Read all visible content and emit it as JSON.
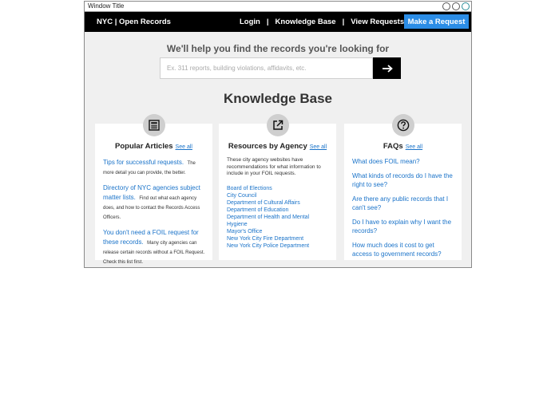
{
  "window": {
    "title": "Window Title"
  },
  "nav": {
    "brand": "NYC | Open Records",
    "links": [
      "Login",
      "Knowledge Base",
      "View Requests"
    ],
    "separator": "|",
    "cta_label": "Make a Request"
  },
  "hero": {
    "title": "We'll help you find the records you're looking for",
    "search_placeholder": "Ex. 311 reports, building violations, affidavits, etc.",
    "search_button_icon": "arrow-right-icon"
  },
  "kb_title": "Knowledge Base",
  "cards": {
    "popular": {
      "icon": "newspaper-icon",
      "title": "Popular Articles",
      "see_all": "See all",
      "articles": [
        {
          "link": "Tips for successful requests.",
          "desc": "The more detail you can provide, the better."
        },
        {
          "link": "Directory of NYC agencies subject matter lists.",
          "desc": "Find out what each agency does, and how to contact the Records Access Officers."
        },
        {
          "link": "You don't need a FOIL request for these records.",
          "desc": "Many city agencies can release certain records without a FOIL Request. Check this list first."
        }
      ]
    },
    "resources": {
      "icon": "external-link-icon",
      "title": "Resources by Agency",
      "see_all": "See all",
      "intro": "These city agency websites have recommendations for what information to include in your FOIL requests.",
      "agencies": [
        "Board of Elections",
        "City Council",
        "Department of Cultural Affairs",
        "Department of Education",
        "Department of Health and Mental Hygiene",
        "Mayor's Office",
        "New York City Fire Department",
        "New York City Police Department"
      ]
    },
    "faqs": {
      "icon": "question-icon",
      "title": "FAQs",
      "see_all": "See all",
      "questions": [
        "What does FOIL mean?",
        "What kinds of records do I have the right to see?",
        "Are there any public records that I can't see?",
        "Do I have to explain why I want the records?",
        "How much does it cost to get access to government records?"
      ]
    }
  }
}
